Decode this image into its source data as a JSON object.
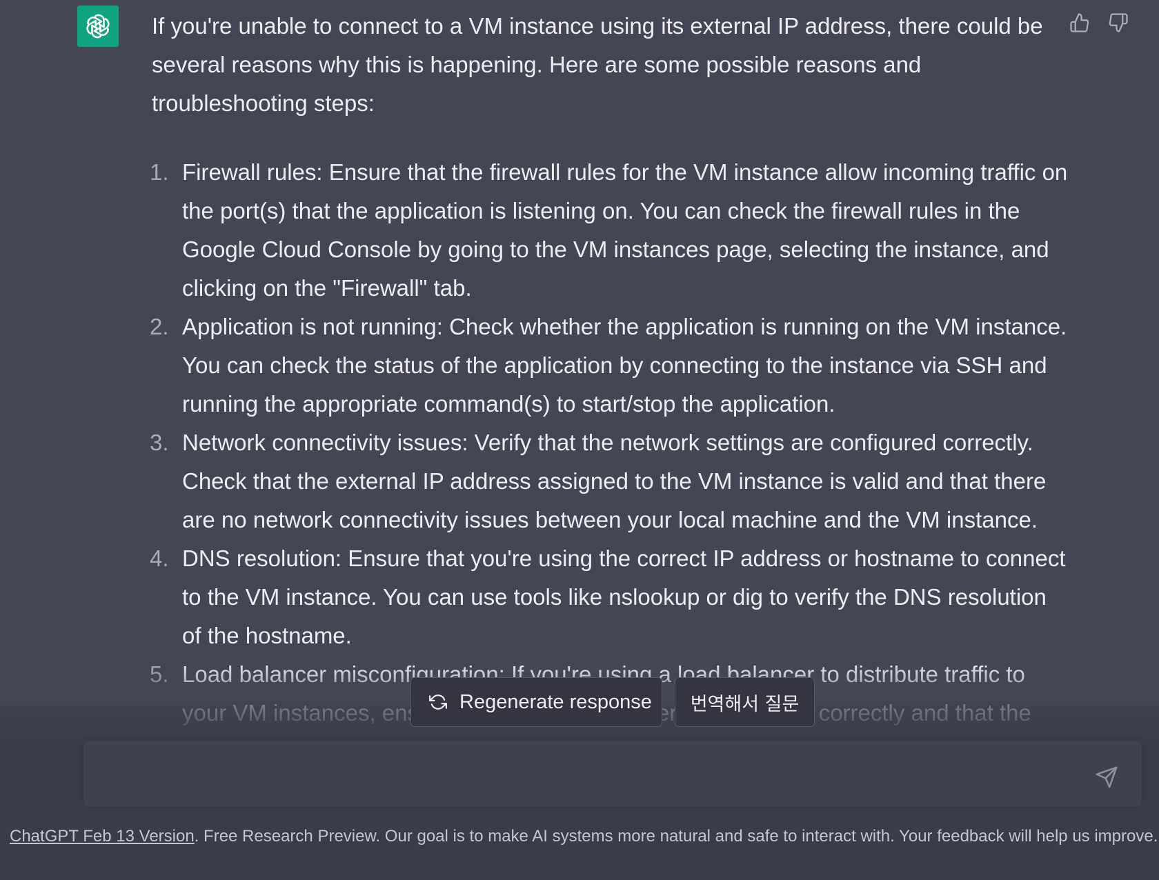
{
  "message": {
    "avatar_icon": "openai-logo-icon",
    "avatar_color": "#10a37f",
    "intro": "If you're unable to connect to a VM instance using its external IP address, there could be several reasons why this is happening. Here are some possible reasons and troubleshooting steps:",
    "items": [
      {
        "number": "1.",
        "text": "Firewall rules: Ensure that the firewall rules for the VM instance allow incoming traffic on the port(s) that the application is listening on. You can check the firewall rules in the Google Cloud Console by going to the VM instances page, selecting the instance, and clicking on the \"Firewall\" tab."
      },
      {
        "number": "2.",
        "text": "Application is not running: Check whether the application is running on the VM instance. You can check the status of the application by connecting to the instance via SSH and running the appropriate command(s) to start/stop the application."
      },
      {
        "number": "3.",
        "text": "Network connectivity issues: Verify that the network settings are configured correctly. Check that the external IP address assigned to the VM instance is valid and that there are no network connectivity issues between your local machine and the VM instance."
      },
      {
        "number": "4.",
        "text": "DNS resolution: Ensure that you're using the correct IP address or hostname to connect to the VM instance. You can use tools like nslookup or dig to verify the DNS resolution of the hostname."
      },
      {
        "number": "5.",
        "text": "Load balancer misconfiguration: If you're using a load balancer to distribute traffic to your VM instances, ensure that the load balancer is configured correctly and that the VM instance is"
      }
    ],
    "feedback": {
      "thumbs_up_icon": "thumbs-up-icon",
      "thumbs_down_icon": "thumbs-down-icon"
    }
  },
  "actions": {
    "regenerate_icon": "refresh-icon",
    "regenerate_label": "Regenerate response",
    "translate_label": "번역해서 질문"
  },
  "composer": {
    "value": "",
    "send_icon": "paper-plane-icon"
  },
  "footer": {
    "version_link": "ChatGPT Feb 13 Version",
    "text": ". Free Research Preview. Our goal is to make AI systems more natural and safe to interact with. Your feedback will help us improve."
  },
  "colors": {
    "message_background": "#444654",
    "bottom_background": "#3a3c4a",
    "input_background": "#40414f",
    "accent": "#10a37f"
  }
}
